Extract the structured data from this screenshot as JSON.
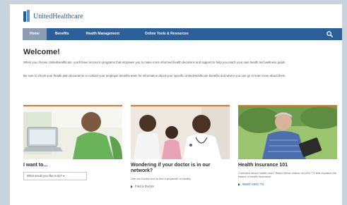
{
  "header": {
    "brand": "UnitedHealthcare"
  },
  "nav": {
    "items": [
      {
        "label": "Home"
      },
      {
        "label": "Benefits"
      },
      {
        "label": "Health Management"
      },
      {
        "label": "Online Tools & Resources"
      }
    ]
  },
  "main": {
    "title": "Welcome!",
    "intro": "When you choose UnitedHealthcare, you'll have access to programs that empower you to make more informed health decisions and support to help you reach your own health and wellness goals.",
    "note": "Be sure to check your health plan documents or contact your employer benefits team for information about your specific UnitedHealthcare benefits and where you can go to learn more about them."
  },
  "cards": [
    {
      "title": "I want to...",
      "select_value": "What would you like to do? ▾"
    },
    {
      "title": "Wondering if your doctor is in our network?",
      "desc": "Use our Doctor tool to find a physician or facility.",
      "link": "Find a Doctor"
    },
    {
      "title": "Health Insurance 101",
      "desc": "Confused about health care? Watch these videos on UHC TV that explains the basics of health insurance.",
      "link": "Watch UHC TV"
    }
  ],
  "colors": {
    "nav": "#2b5f99",
    "accent": "#e87722",
    "brand": "#1f5ea8"
  },
  "icons": {
    "search": "search-icon",
    "link_arrow": "arrow-right-icon",
    "logo": "uhc-logo-icon"
  }
}
